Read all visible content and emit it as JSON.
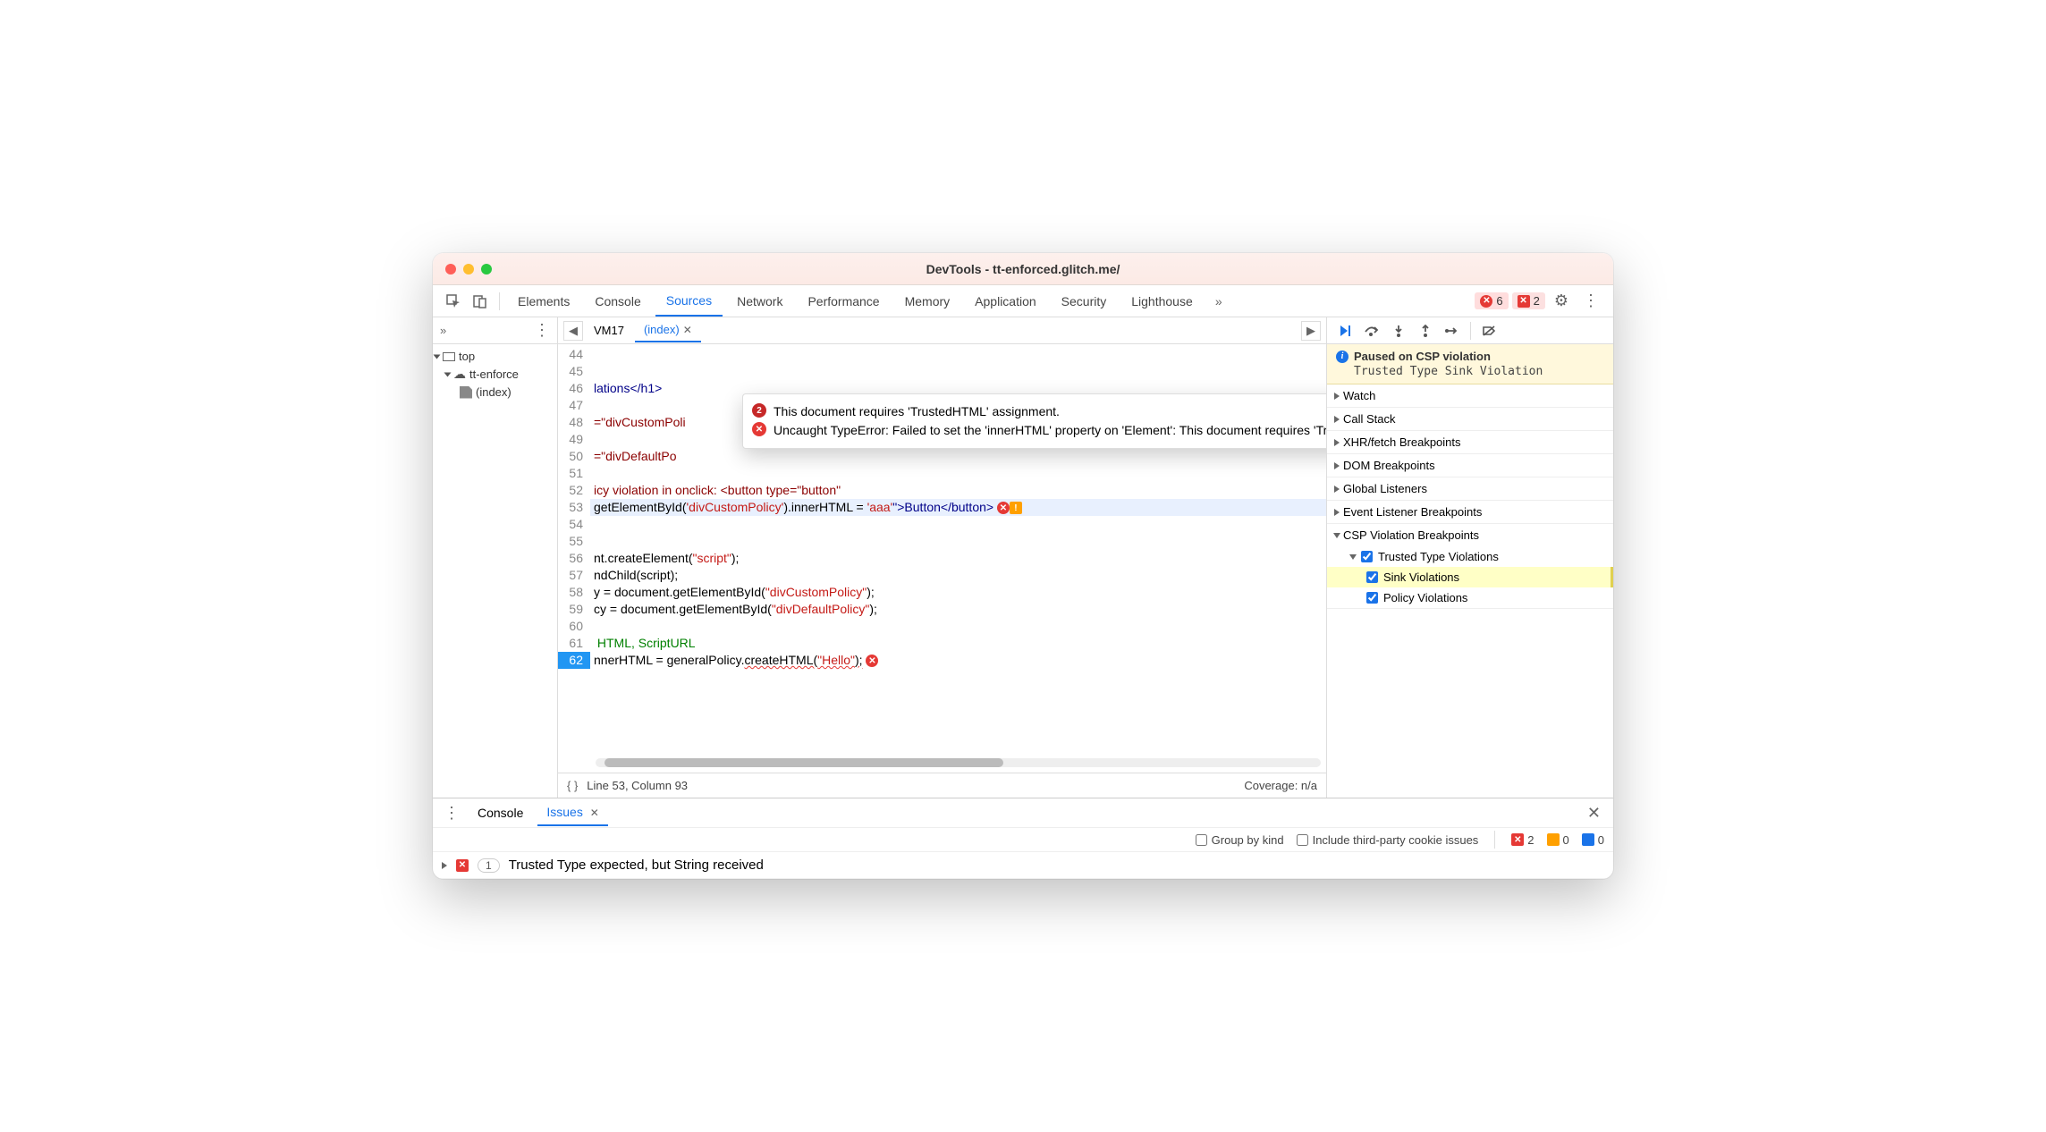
{
  "window_title": "DevTools - tt-enforced.glitch.me/",
  "toolbar": {
    "tabs": [
      "Elements",
      "Console",
      "Sources",
      "Network",
      "Performance",
      "Memory",
      "Application",
      "Security",
      "Lighthouse"
    ],
    "active_tab": "Sources",
    "error_count": "6",
    "issue_count": "2"
  },
  "file_tree": {
    "top": "top",
    "domain": "tt-enforce",
    "file": "(index)"
  },
  "editor": {
    "tabs": [
      {
        "label": "VM17"
      },
      {
        "label": "(index)",
        "active": true
      }
    ],
    "lines": {
      "start": 44,
      "exec": 62
    },
    "code": {
      "l46": "lations</h1>",
      "l48": "=\"divCustomPoli",
      "l50": "=\"divDefaultPo",
      "l52": "icy violation in onclick: <button type=\"button\"",
      "l53a": "getElementById(",
      "l53b": "'divCustomPolicy'",
      "l53c": ").innerHTML = ",
      "l53d": "'aaa'",
      "l53e": "\">Button</button>",
      "l56": "nt.createElement(\"script\");",
      "l57": "ndChild(script);",
      "l58": "y = document.getElementById(\"divCustomPolicy\");",
      "l59": "cy = document.getElementById(\"divDefaultPolicy\");",
      "l61": " HTML, ScriptURL",
      "l62a": "nnerHTML = generalPolicy.",
      "l62b": "createHTML(",
      "l62c": "\"Hello\"",
      "l62d": ");"
    },
    "status_left": "Line 53, Column 93",
    "status_right": "Coverage: n/a"
  },
  "tooltip": {
    "count": "2",
    "msg1": "This document requires 'TrustedHTML' assignment.",
    "msg2": "Uncaught TypeError: Failed to set the 'innerHTML' property on 'Element': This document requires 'TrustedHTML' assignment."
  },
  "debugger": {
    "paused_title": "Paused on CSP violation",
    "paused_sub": "Trusted Type Sink Violation",
    "sections": [
      "Watch",
      "Call Stack",
      "XHR/fetch Breakpoints",
      "DOM Breakpoints",
      "Global Listeners",
      "Event Listener Breakpoints",
      "CSP Violation Breakpoints"
    ],
    "csp": {
      "parent": "Trusted Type Violations",
      "sink": "Sink Violations",
      "policy": "Policy Violations"
    }
  },
  "bottom": {
    "tabs": {
      "console": "Console",
      "issues": "Issues"
    },
    "group_label": "Group by kind",
    "third_party": "Include third-party cookie issues",
    "counts": {
      "err": "2",
      "warn": "0",
      "info": "0"
    },
    "issue1_count": "1",
    "issue1": "Trusted Type expected, but String received"
  }
}
